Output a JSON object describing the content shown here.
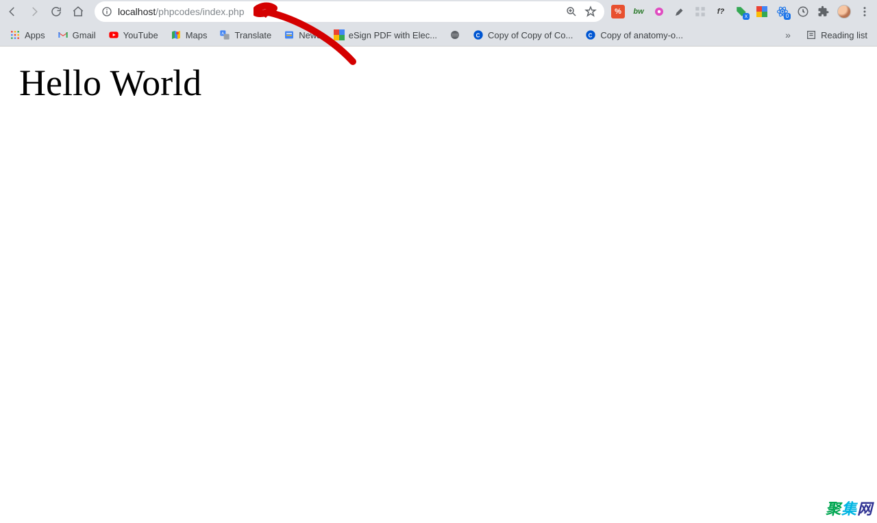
{
  "toolbar": {
    "url_host": "localhost",
    "url_path": "/phpcodes/index.php"
  },
  "bookmarks": {
    "apps": "Apps",
    "gmail": "Gmail",
    "youtube": "YouTube",
    "maps": "Maps",
    "translate": "Translate",
    "news": "News",
    "esign": "eSign PDF with Elec...",
    "copy1": "Copy of Copy of Co...",
    "copy2": "Copy of anatomy-o...",
    "reading_list": "Reading list"
  },
  "extensions": {
    "react_badge": "0",
    "f_query": "f?",
    "x_badge": "x"
  },
  "page": {
    "heading": "Hello World"
  },
  "watermark": "聚集网"
}
